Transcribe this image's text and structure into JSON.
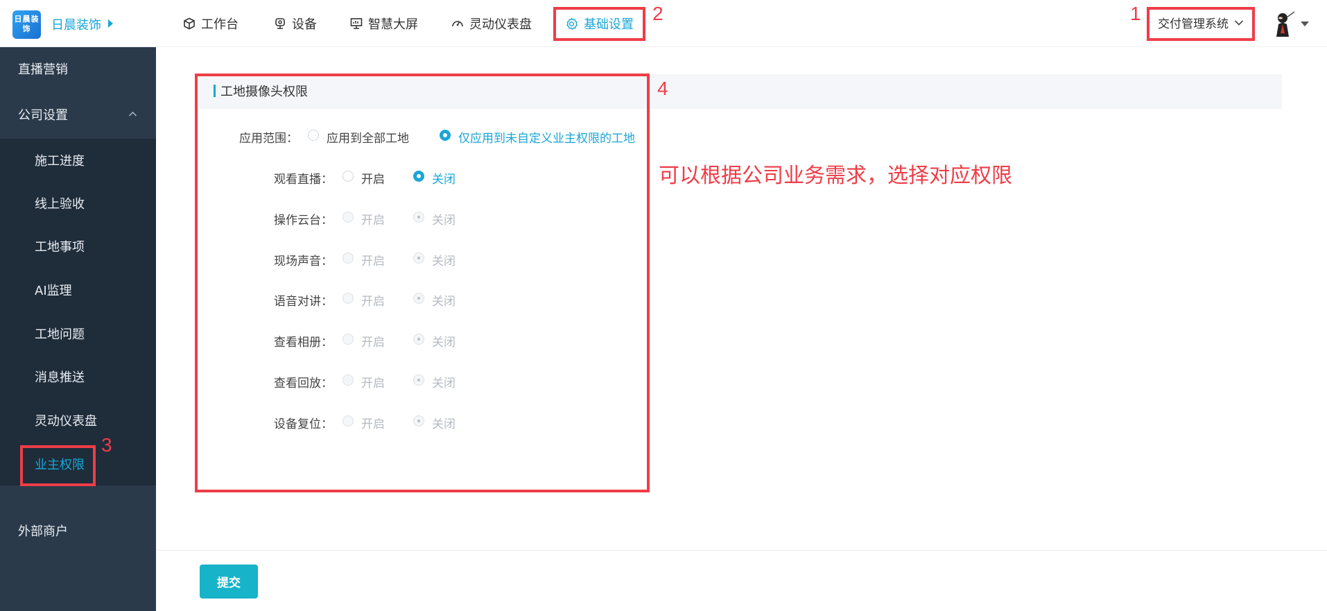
{
  "header": {
    "logo_text": "日晨装饰",
    "brand": "日晨装饰",
    "nav": [
      {
        "label": "工作台",
        "icon": "cube-icon"
      },
      {
        "label": "设备",
        "icon": "camera-icon"
      },
      {
        "label": "智慧大屏",
        "icon": "monitor-icon"
      },
      {
        "label": "灵动仪表盘",
        "icon": "gauge-icon"
      },
      {
        "label": "基础设置",
        "icon": "gear-icon",
        "active": true
      }
    ],
    "system_select": "交付管理系统"
  },
  "sidebar": {
    "items": [
      {
        "label": "直播营销"
      },
      {
        "label": "公司设置",
        "expanded": true
      },
      {
        "label": "外部商户"
      }
    ],
    "sub_items": [
      {
        "label": "施工进度"
      },
      {
        "label": "线上验收"
      },
      {
        "label": "工地事项"
      },
      {
        "label": "AI监理"
      },
      {
        "label": "工地问题"
      },
      {
        "label": "消息推送"
      },
      {
        "label": "灵动仪表盘"
      },
      {
        "label": "业主权限",
        "active": true
      }
    ]
  },
  "section": {
    "title": "工地摄像头权限"
  },
  "form": {
    "scope": {
      "label": "应用范围：",
      "options": [
        "应用到全部工地",
        "仅应用到未自定义业主权限的工地"
      ],
      "selected": "仅应用到未自定义业主权限的工地"
    },
    "rows": [
      {
        "label": "观看直播：",
        "on": "开启",
        "off": "关闭",
        "selected": "关闭",
        "disabled": false
      },
      {
        "label": "操作云台：",
        "on": "开启",
        "off": "关闭",
        "selected": "关闭",
        "disabled": true
      },
      {
        "label": "现场声音：",
        "on": "开启",
        "off": "关闭",
        "selected": "关闭",
        "disabled": true
      },
      {
        "label": "语音对讲：",
        "on": "开启",
        "off": "关闭",
        "selected": "关闭",
        "disabled": true
      },
      {
        "label": "查看相册：",
        "on": "开启",
        "off": "关闭",
        "selected": "关闭",
        "disabled": true
      },
      {
        "label": "查看回放：",
        "on": "开启",
        "off": "关闭",
        "selected": "关闭",
        "disabled": true
      },
      {
        "label": "设备复位：",
        "on": "开启",
        "off": "关闭",
        "selected": "关闭",
        "disabled": true
      }
    ]
  },
  "submit_label": "提交",
  "annotations": {
    "numbers": [
      "1",
      "2",
      "3",
      "4"
    ],
    "note": "可以根据公司业务需求，选择对应权限"
  },
  "colors": {
    "accent": "#1aa6d6",
    "sidebar_bg": "#2b3a4a",
    "annotation": "#ee3d48"
  }
}
